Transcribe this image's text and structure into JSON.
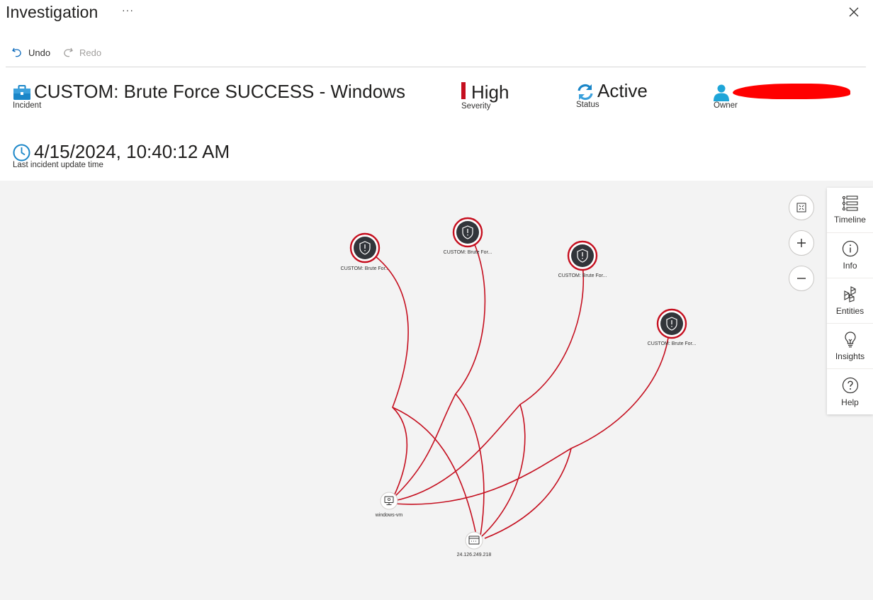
{
  "window": {
    "title": "Investigation",
    "more_label": "···"
  },
  "toolbar": {
    "undo_label": "Undo",
    "redo_label": "Redo"
  },
  "incident": {
    "title": "CUSTOM: Brute Force SUCCESS - Windows",
    "title_caption": "Incident",
    "severity": "High",
    "severity_caption": "Severity",
    "severity_color": "#c50f1f",
    "status": "Active",
    "status_caption": "Status",
    "owner_caption": "Owner",
    "last_update": "4/15/2024, 10:40:12 AM",
    "last_update_caption": "Last incident update time"
  },
  "graph": {
    "alerts": [
      {
        "label": "CUSTOM: Brute For..."
      },
      {
        "label": "CUSTOM: Brute For..."
      },
      {
        "label": "CUSTOM: Brute For..."
      },
      {
        "label": "CUSTOM: Brute For..."
      }
    ],
    "entities": [
      {
        "label": "windows-vm",
        "icon": "computer-icon"
      },
      {
        "label": "24.126.249.218",
        "icon": "ip-address-icon"
      }
    ],
    "edge_color": "#c50f1f"
  },
  "side_panel": {
    "items": [
      {
        "label": "Timeline",
        "icon": "timeline-icon"
      },
      {
        "label": "Info",
        "icon": "info-icon"
      },
      {
        "label": "Entities",
        "icon": "entities-icon"
      },
      {
        "label": "Insights",
        "icon": "lightbulb-icon"
      },
      {
        "label": "Help",
        "icon": "help-icon"
      }
    ]
  }
}
